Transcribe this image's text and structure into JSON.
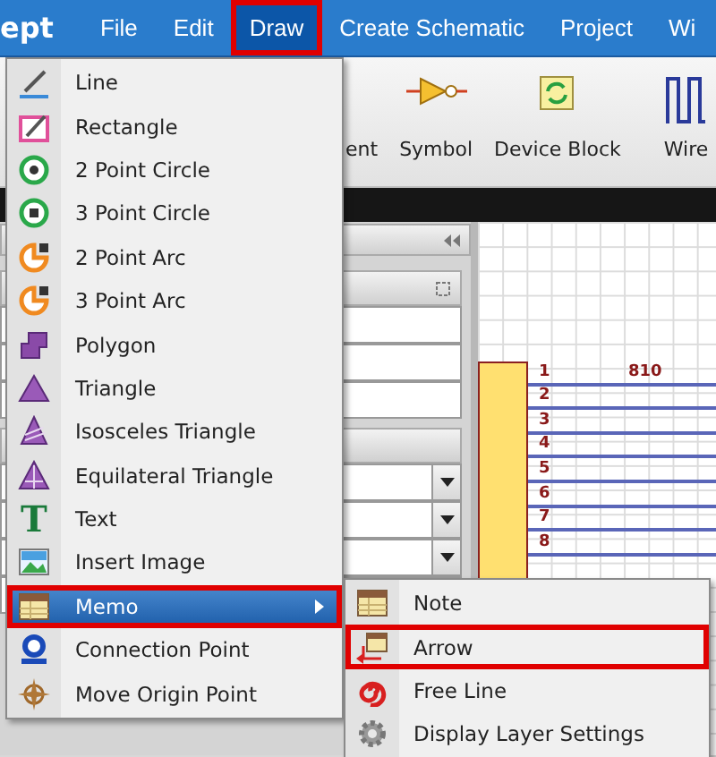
{
  "app_name": "ept",
  "menu_bar": [
    {
      "label": "File",
      "selected": false,
      "outlined": false
    },
    {
      "label": "Edit",
      "selected": false,
      "outlined": false
    },
    {
      "label": "Draw",
      "selected": true,
      "outlined": true
    },
    {
      "label": "Create Schematic",
      "selected": false,
      "outlined": false
    },
    {
      "label": "Project",
      "selected": false,
      "outlined": false
    },
    {
      "label": "Wi",
      "selected": false,
      "outlined": false
    }
  ],
  "ribbon": {
    "buttons": [
      {
        "label": "ent"
      },
      {
        "label": "Symbol"
      },
      {
        "label": "Device Block"
      },
      {
        "label": "Wire"
      }
    ]
  },
  "canvas": {
    "pins": [
      {
        "number": "1",
        "label": "810"
      },
      {
        "number": "2"
      },
      {
        "number": "3"
      },
      {
        "number": "4"
      },
      {
        "number": "5"
      },
      {
        "number": "6"
      },
      {
        "number": "7"
      },
      {
        "number": "8"
      }
    ]
  },
  "draw_menu": {
    "items": [
      {
        "label": "Line",
        "selected": false,
        "outlined": false,
        "has_submenu": false
      },
      {
        "label": "Rectangle",
        "selected": false,
        "outlined": false,
        "has_submenu": false
      },
      {
        "label": "2 Point Circle",
        "selected": false,
        "outlined": false,
        "has_submenu": false
      },
      {
        "label": "3 Point Circle",
        "selected": false,
        "outlined": false,
        "has_submenu": false
      },
      {
        "label": "2 Point Arc",
        "selected": false,
        "outlined": false,
        "has_submenu": false
      },
      {
        "label": "3 Point Arc",
        "selected": false,
        "outlined": false,
        "has_submenu": false
      },
      {
        "label": "Polygon",
        "selected": false,
        "outlined": false,
        "has_submenu": false
      },
      {
        "label": "Triangle",
        "selected": false,
        "outlined": false,
        "has_submenu": false
      },
      {
        "label": "Isosceles Triangle",
        "selected": false,
        "outlined": false,
        "has_submenu": false
      },
      {
        "label": "Equilateral Triangle",
        "selected": false,
        "outlined": false,
        "has_submenu": false
      },
      {
        "label": "Text",
        "icon_glyph": "T",
        "selected": false,
        "outlined": false,
        "has_submenu": false
      },
      {
        "label": "Insert Image",
        "selected": false,
        "outlined": false,
        "has_submenu": false
      },
      {
        "label": "Memo",
        "selected": true,
        "outlined": true,
        "has_submenu": true
      },
      {
        "label": "Connection Point",
        "selected": false,
        "outlined": false,
        "has_submenu": false
      },
      {
        "label": "Move Origin Point",
        "selected": false,
        "outlined": false,
        "has_submenu": false
      }
    ]
  },
  "memo_submenu": {
    "items": [
      {
        "label": "Note",
        "selected": false,
        "outlined": false
      },
      {
        "label": "Arrow",
        "selected": false,
        "outlined": true
      },
      {
        "label": "Free Line",
        "selected": false,
        "outlined": false
      },
      {
        "label": "Display Layer Settings",
        "selected": false,
        "outlined": false
      }
    ]
  }
}
